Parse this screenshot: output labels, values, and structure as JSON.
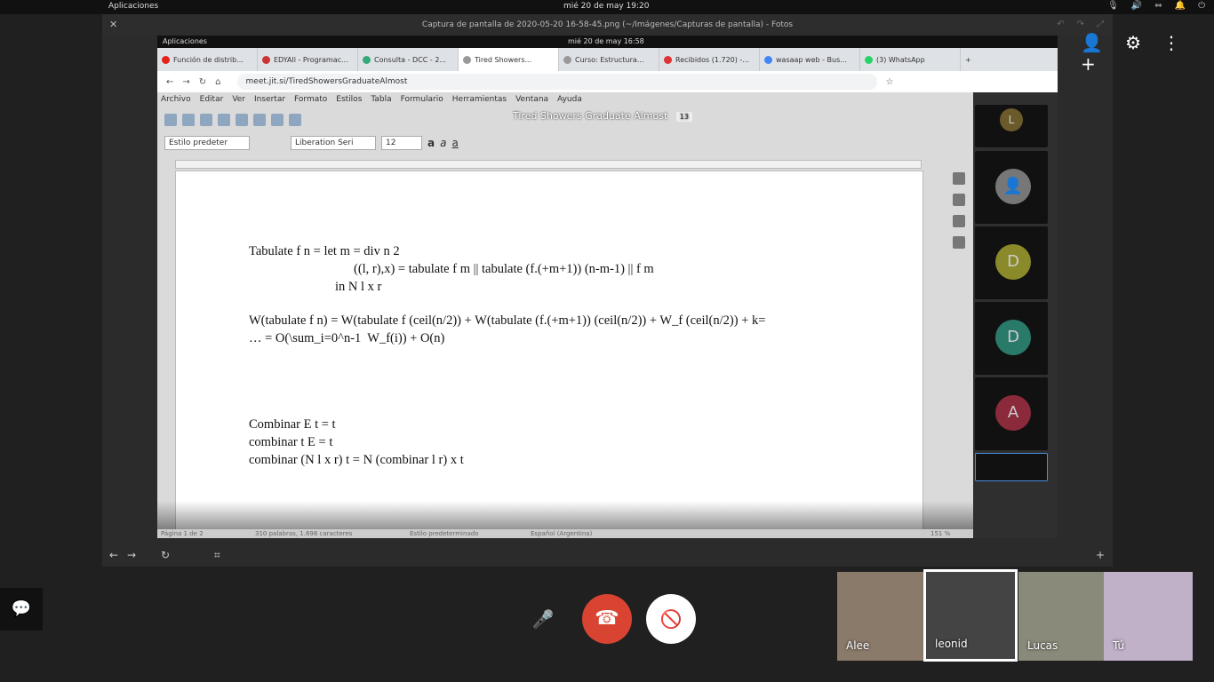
{
  "system": {
    "apps_label": "Aplicaciones",
    "clock": "mié 20 de may    19:20"
  },
  "photos_window": {
    "title": "Captura de pantalla de 2020-05-20 16-58-45.png (~/Imágenes/Capturas de pantalla) - Fotos"
  },
  "inner_system": {
    "apps_label": "Aplicaciones",
    "clock": "mié 20 de may    16:58"
  },
  "browser": {
    "tabs": [
      "Función de distrib...",
      "EDYAll - Programac...",
      "Consulta - DCC - 2...",
      "Tired Showers...",
      "Curso: Estructura...",
      "Recibidos (1.720) -...",
      "wasaap web - Bus...",
      "(3) WhatsApp"
    ],
    "url": "meet.jit.si/TiredShowersGraduateAlmost"
  },
  "libreoffice": {
    "menu": [
      "Archivo",
      "Editar",
      "Ver",
      "Insertar",
      "Formato",
      "Estilos",
      "Tabla",
      "Formulario",
      "Herramientas",
      "Ventana",
      "Ayuda"
    ],
    "style": "Estilo predeter",
    "font": "Liberation Seri",
    "size": "12",
    "status_left": "Página 1 de 2",
    "status_words": "310 palabras, 1.698 caracteres",
    "status_style": "Estilo predeterminado",
    "status_lang": "Español (Argentina)",
    "zoom": "151 %"
  },
  "meeting": {
    "title": "Tired Showers Graduate Almost",
    "participants_count": "13"
  },
  "document_lines": [
    "Tabulate f n = let m = div n 2",
    "((l, r),x) = tabulate f m || tabulate (f.(+m+1)) (n-m-1) || f m",
    "in N l x r",
    "W(tabulate f n) = W(tabulate f (ceil(n/2)) + W(tabulate (f.(+m+1)) (ceil(n/2)) + W_f (ceil(n/2)) + k=",
    "… = O(\\sum_i=0^n-1  W_f(i)) + O(n)",
    "Combinar E t = t",
    "combinar t E = t",
    "combinar (N l x r) t = N (combinar l r) x t"
  ],
  "tiles": [
    {
      "letter": "L",
      "color": "#6b5a2a"
    },
    {
      "letter": "",
      "color": "#777777"
    },
    {
      "letter": "D",
      "color": "#8a8a2a"
    },
    {
      "letter": "D",
      "color": "#2a7a6a"
    },
    {
      "letter": "A",
      "color": "#8a2a3a"
    }
  ],
  "thumbs": [
    {
      "name": "Alee"
    },
    {
      "name": "leonid"
    },
    {
      "name": "Lucas"
    },
    {
      "name": "Tú"
    }
  ],
  "icons": {
    "add_person": "add-person-icon",
    "settings": "gear-icon",
    "more": "more-vertical-icon",
    "mic": "microphone-icon",
    "hangup": "hangup-icon",
    "camera_off": "camera-off-icon",
    "chat": "chat-icon"
  }
}
